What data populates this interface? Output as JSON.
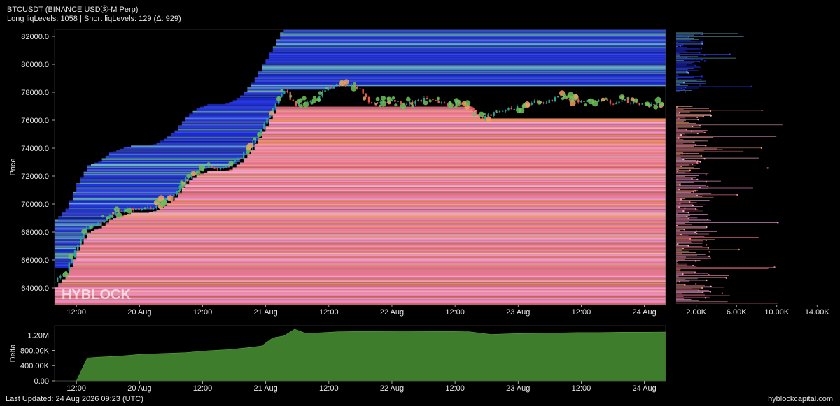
{
  "header": {
    "title": "BTCUSDT (BINANCE USDⓈ-M Perp)",
    "subtitle": "Long liqLevels: 1058 | Short liqLevels: 129 (Δ: 929)"
  },
  "footer": {
    "last_updated": "Last Updated: 24 Aug 2026 09:23 (UTC)",
    "site": "hyblockcapital.com"
  },
  "watermark": "HYBLOCK",
  "colors": {
    "background": "#000000",
    "price_up": "#26a69a",
    "price_down": "#ef5350",
    "delta_fill": "#3e7d2c",
    "short_levels": "#2b3cf0",
    "long_levels": "#f07a8c",
    "bubble": "#6fbf5a"
  },
  "chart_data": [
    {
      "type": "line",
      "name": "price-panel",
      "ylabel": "Price",
      "ylim": [
        62800,
        82500
      ],
      "yticks": [
        "82000.0",
        "80000.0",
        "78000.0",
        "76000.0",
        "74000.0",
        "72000.0",
        "70000.0",
        "68000.0",
        "66000.0",
        "64000.0"
      ],
      "xticks": [
        "12:00",
        "20 Aug",
        "12:00",
        "21 Aug",
        "12:00",
        "22 Aug",
        "12:00",
        "23 Aug",
        "12:00",
        "24 Aug"
      ],
      "x": [
        0,
        3,
        6,
        9,
        12,
        15,
        18,
        21,
        24,
        27,
        30,
        33,
        36,
        39,
        42,
        45,
        48,
        51,
        54,
        57,
        60,
        63,
        66,
        69,
        72,
        75,
        78,
        81,
        84,
        87,
        90,
        93,
        96,
        99,
        102,
        105,
        108,
        111,
        114,
        117,
        120,
        123,
        126,
        129,
        132,
        135,
        138,
        141,
        144,
        147,
        150,
        153,
        156,
        159,
        162,
        165,
        168
      ],
      "price": [
        64400,
        65200,
        67000,
        68300,
        68600,
        69200,
        69500,
        69700,
        69600,
        69800,
        70200,
        70800,
        71800,
        72400,
        72700,
        72600,
        72800,
        73300,
        74200,
        75500,
        76800,
        78300,
        77100,
        77300,
        77500,
        78300,
        78600,
        78500,
        78200,
        77200,
        77300,
        77400,
        77200,
        77300,
        77500,
        77400,
        77100,
        77300,
        77000,
        76100,
        76400,
        76700,
        76900,
        77000,
        77300,
        77200,
        77700,
        77600,
        77400,
        77300,
        77500,
        77200,
        77400,
        77300,
        77100,
        77200,
        77100
      ],
      "levels_top_time_sample": "liquidation level bands above (short) and below (long) price"
    },
    {
      "type": "bar",
      "name": "liq-levels-histogram",
      "xticks": [
        "2.00K",
        "6.00K",
        "10.00K",
        "14.00K"
      ],
      "xlim": [
        0,
        16000
      ]
    },
    {
      "type": "area",
      "name": "delta-panel",
      "ylabel": "Delta",
      "ylim": [
        0,
        1450000
      ],
      "yticks": [
        "1.20M",
        "800.00K",
        "400.00K",
        "0.00"
      ],
      "xticks": [
        "12:00",
        "20 Aug",
        "12:00",
        "21 Aug",
        "12:00",
        "22 Aug",
        "12:00",
        "23 Aug",
        "12:00",
        "24 Aug"
      ],
      "x": [
        0,
        6,
        9,
        12,
        18,
        24,
        30,
        36,
        42,
        48,
        54,
        57,
        60,
        63,
        66,
        69,
        72,
        78,
        84,
        90,
        96,
        102,
        108,
        114,
        120,
        126,
        132,
        138,
        144,
        150,
        156,
        162,
        168
      ],
      "values": [
        0,
        0,
        600000,
        620000,
        650000,
        700000,
        720000,
        740000,
        790000,
        820000,
        880000,
        920000,
        1130000,
        1180000,
        1360000,
        1250000,
        1260000,
        1290000,
        1300000,
        1300000,
        1310000,
        1300000,
        1300000,
        1290000,
        1220000,
        1240000,
        1250000,
        1260000,
        1270000,
        1270000,
        1280000,
        1280000,
        1285000
      ]
    }
  ]
}
